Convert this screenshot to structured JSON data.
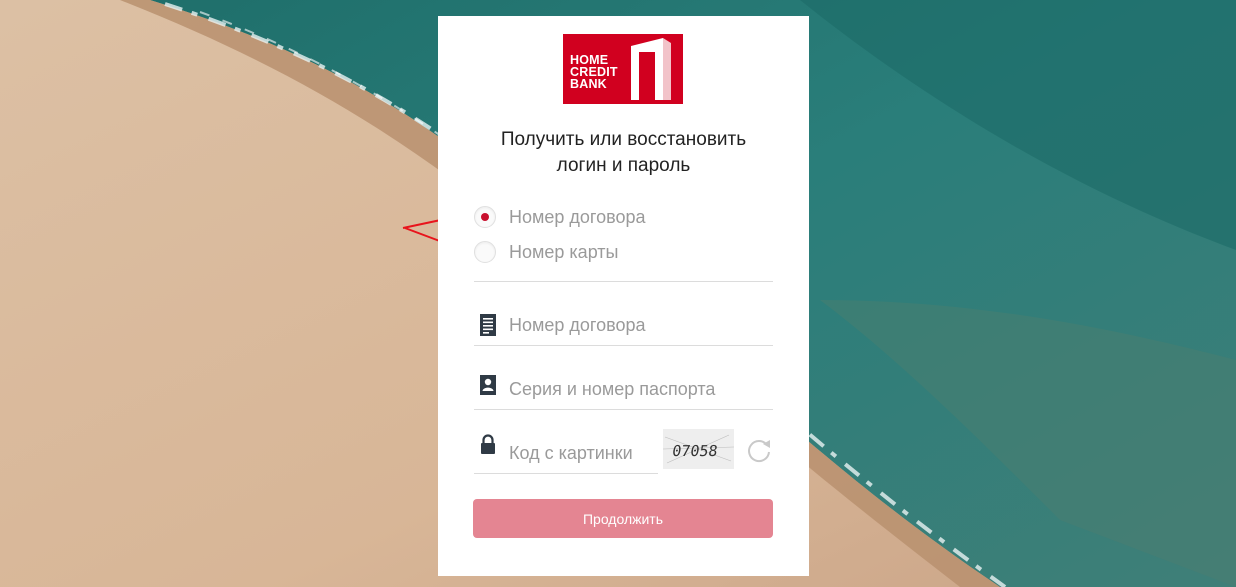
{
  "brand": {
    "logo_lines": [
      "HOME",
      "CREDIT",
      "BANK"
    ],
    "color": "#d1001f"
  },
  "form": {
    "heading_lines": [
      "Получить или восстановить",
      "логин и пароль"
    ],
    "radio_options": [
      {
        "label": "Номер договора",
        "selected": true
      },
      {
        "label": "Номер карты",
        "selected": false
      }
    ],
    "fields": {
      "contract": {
        "placeholder": "Номер договора",
        "value": "",
        "icon": "document-icon"
      },
      "passport": {
        "placeholder": "Серия и номер паспорта",
        "value": "",
        "icon": "person-icon"
      },
      "captcha": {
        "placeholder": "Код с картинки",
        "value": "",
        "icon": "lock-icon",
        "image_text": "07058"
      }
    },
    "refresh_icon": "refresh-icon",
    "submit_label": "Продолжить",
    "submit_color": "#e48592"
  },
  "annotation": {
    "arrow_color": "#e8141c"
  }
}
